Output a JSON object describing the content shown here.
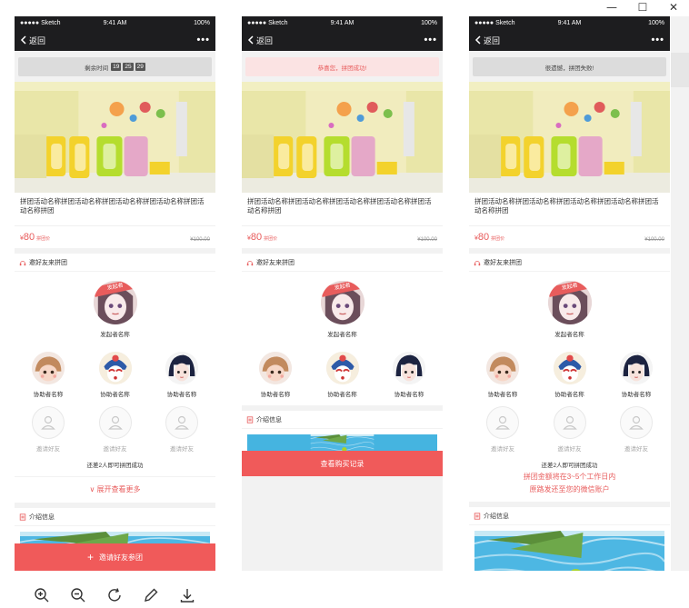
{
  "window": {
    "minimize": "—",
    "maximize": "☐",
    "close": "✕"
  },
  "status": {
    "carrier": "●●●●● Sketch",
    "time": "9:41 AM",
    "battery": "100%"
  },
  "nav": {
    "back": "返回",
    "more": "•••"
  },
  "screens": [
    {
      "notice": "剩余时间",
      "timer": [
        "19",
        "25",
        "29"
      ],
      "cta": "邀请好友参团"
    },
    {
      "notice": "恭喜您，拼团成功!",
      "cta": "查看购买记录"
    },
    {
      "notice": "很遗憾，拼团失败!",
      "refund_line1": "拼团金额将在3~5个工作日内",
      "refund_line2": "原路发还至您的微信账户"
    }
  ],
  "product": {
    "title": "拼团活动名称拼团活动名称拼团活动名称拼团活动名称拼团活动名称拼团",
    "price_currency": "¥",
    "price": "80",
    "price_tag": "拼团价",
    "old_price": "¥100.00"
  },
  "invite": {
    "header": "邀好友来拼团",
    "ribbon": "发起者",
    "founder_name": "发起者名称",
    "helper_name": "协助者名称",
    "invite_label": "邀请好友",
    "status": "还差2人即可拼团成功",
    "expand": "∨ 展开查看更多"
  },
  "intro": {
    "header": "介绍信息"
  },
  "colors": {
    "accent": "#f05a5a",
    "dark": "#1d1d1f"
  },
  "toolbar": [
    "zoom-in-icon",
    "zoom-out-icon",
    "rotate-icon",
    "edit-icon",
    "download-icon"
  ]
}
